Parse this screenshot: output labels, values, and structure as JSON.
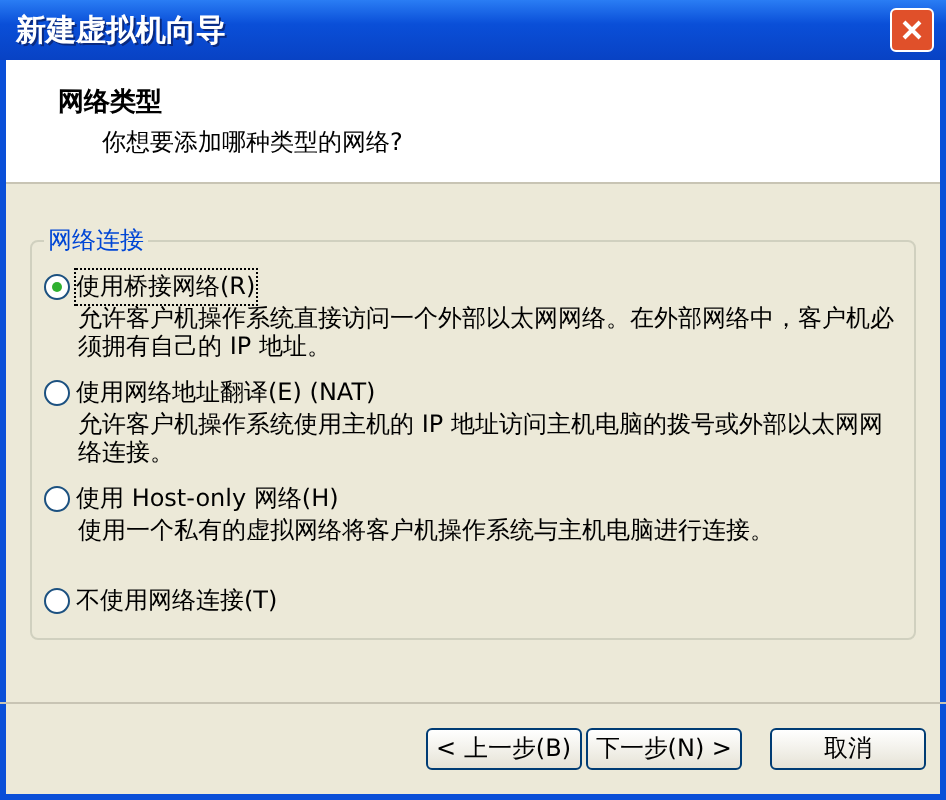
{
  "window": {
    "title": "新建虚拟机向导"
  },
  "header": {
    "title": "网络类型",
    "subtitle": "你想要添加哪种类型的网络?"
  },
  "group": {
    "title": "网络连接",
    "options": [
      {
        "label": "使用桥接网络(R)",
        "description": "允许客户机操作系统直接访问一个外部以太网网络。在外部网络中，客户机必须拥有自己的 IP 地址。",
        "selected": true
      },
      {
        "label": "使用网络地址翻译(E) (NAT)",
        "description": "允许客户机操作系统使用主机的 IP 地址访问主机电脑的拨号或外部以太网网络连接。",
        "selected": false
      },
      {
        "label": "使用 Host-only 网络(H)",
        "description": "使用一个私有的虚拟网络将客户机操作系统与主机电脑进行连接。",
        "selected": false
      },
      {
        "label": "不使用网络连接(T)",
        "selected": false
      }
    ]
  },
  "buttons": [
    {
      "label": "< 上一步(B)",
      "kind": "back"
    },
    {
      "label": "下一步(N) >",
      "kind": "next"
    },
    {
      "label": "取消",
      "kind": "cancel"
    }
  ]
}
